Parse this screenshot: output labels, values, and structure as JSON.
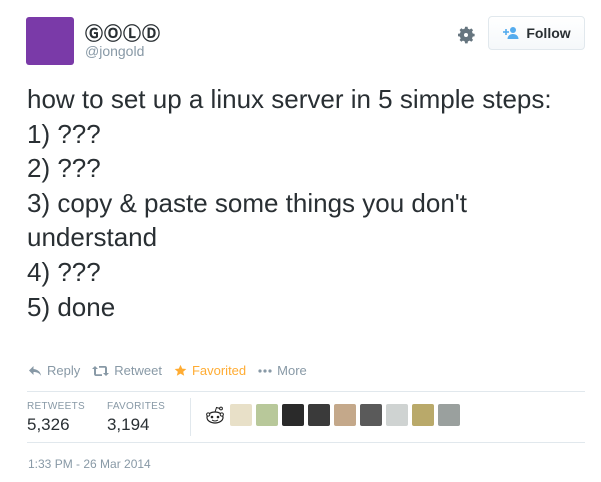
{
  "user": {
    "display_name": "ⒼⓄⓁⒹ",
    "handle": "@jongold",
    "avatar_color": "#7a3aa8"
  },
  "follow_button": {
    "label": "Follow",
    "icon": "add-user-icon"
  },
  "settings_icon": "gear-icon",
  "tweet": {
    "text": "how to set up a linux server in 5 simple steps:\n1) ???\n2) ???\n3) copy & paste some things you don't understand\n4) ???\n5) done"
  },
  "actions": {
    "reply": "Reply",
    "retweet": "Retweet",
    "favorited": "Favorited",
    "more": "More"
  },
  "stats": {
    "retweets_label": "RETWEETS",
    "retweets_value": "5,326",
    "favorites_label": "FAVORITES",
    "favorites_value": "3,194"
  },
  "favoriters": [
    {
      "icon": "reddit-alien-icon",
      "color": "#ffffff"
    },
    {
      "color": "#e8e0c8"
    },
    {
      "color": "#b8c89a"
    },
    {
      "color": "#2a2a2a"
    },
    {
      "color": "#3a3a3a"
    },
    {
      "color": "#c4a88a"
    },
    {
      "color": "#5a5a5a"
    },
    {
      "color": "#cfd3d2"
    },
    {
      "color": "#b9a96a"
    },
    {
      "color": "#9aa09e"
    }
  ],
  "timestamp": "1:33 PM - 26 Mar 2014"
}
